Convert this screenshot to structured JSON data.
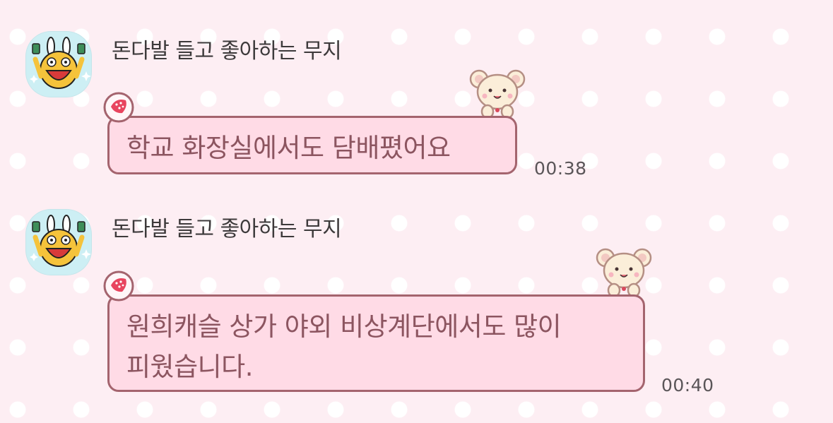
{
  "messages": [
    {
      "sender": "돈다발 들고 좋아하는 무지",
      "avatar_icon": "muzi-money-icon",
      "text_lines": [
        "학교 화장실에서도 담배폈어요"
      ],
      "time": "00:38"
    },
    {
      "sender": "돈다발 들고 좋아하는 무지",
      "avatar_icon": "muzi-money-icon",
      "text_lines": [
        "원희캐슬 상가 야외 비상계단에서도 많이",
        "피웠습니다."
      ],
      "time": "00:40"
    }
  ],
  "colors": {
    "background": "#fdeef3",
    "dots": "#ffffff",
    "bubble_fill": "#ffdbe6",
    "bubble_border": "#a4646e",
    "bubble_text": "#8c5560",
    "avatar_bg": "#cdeff4"
  }
}
